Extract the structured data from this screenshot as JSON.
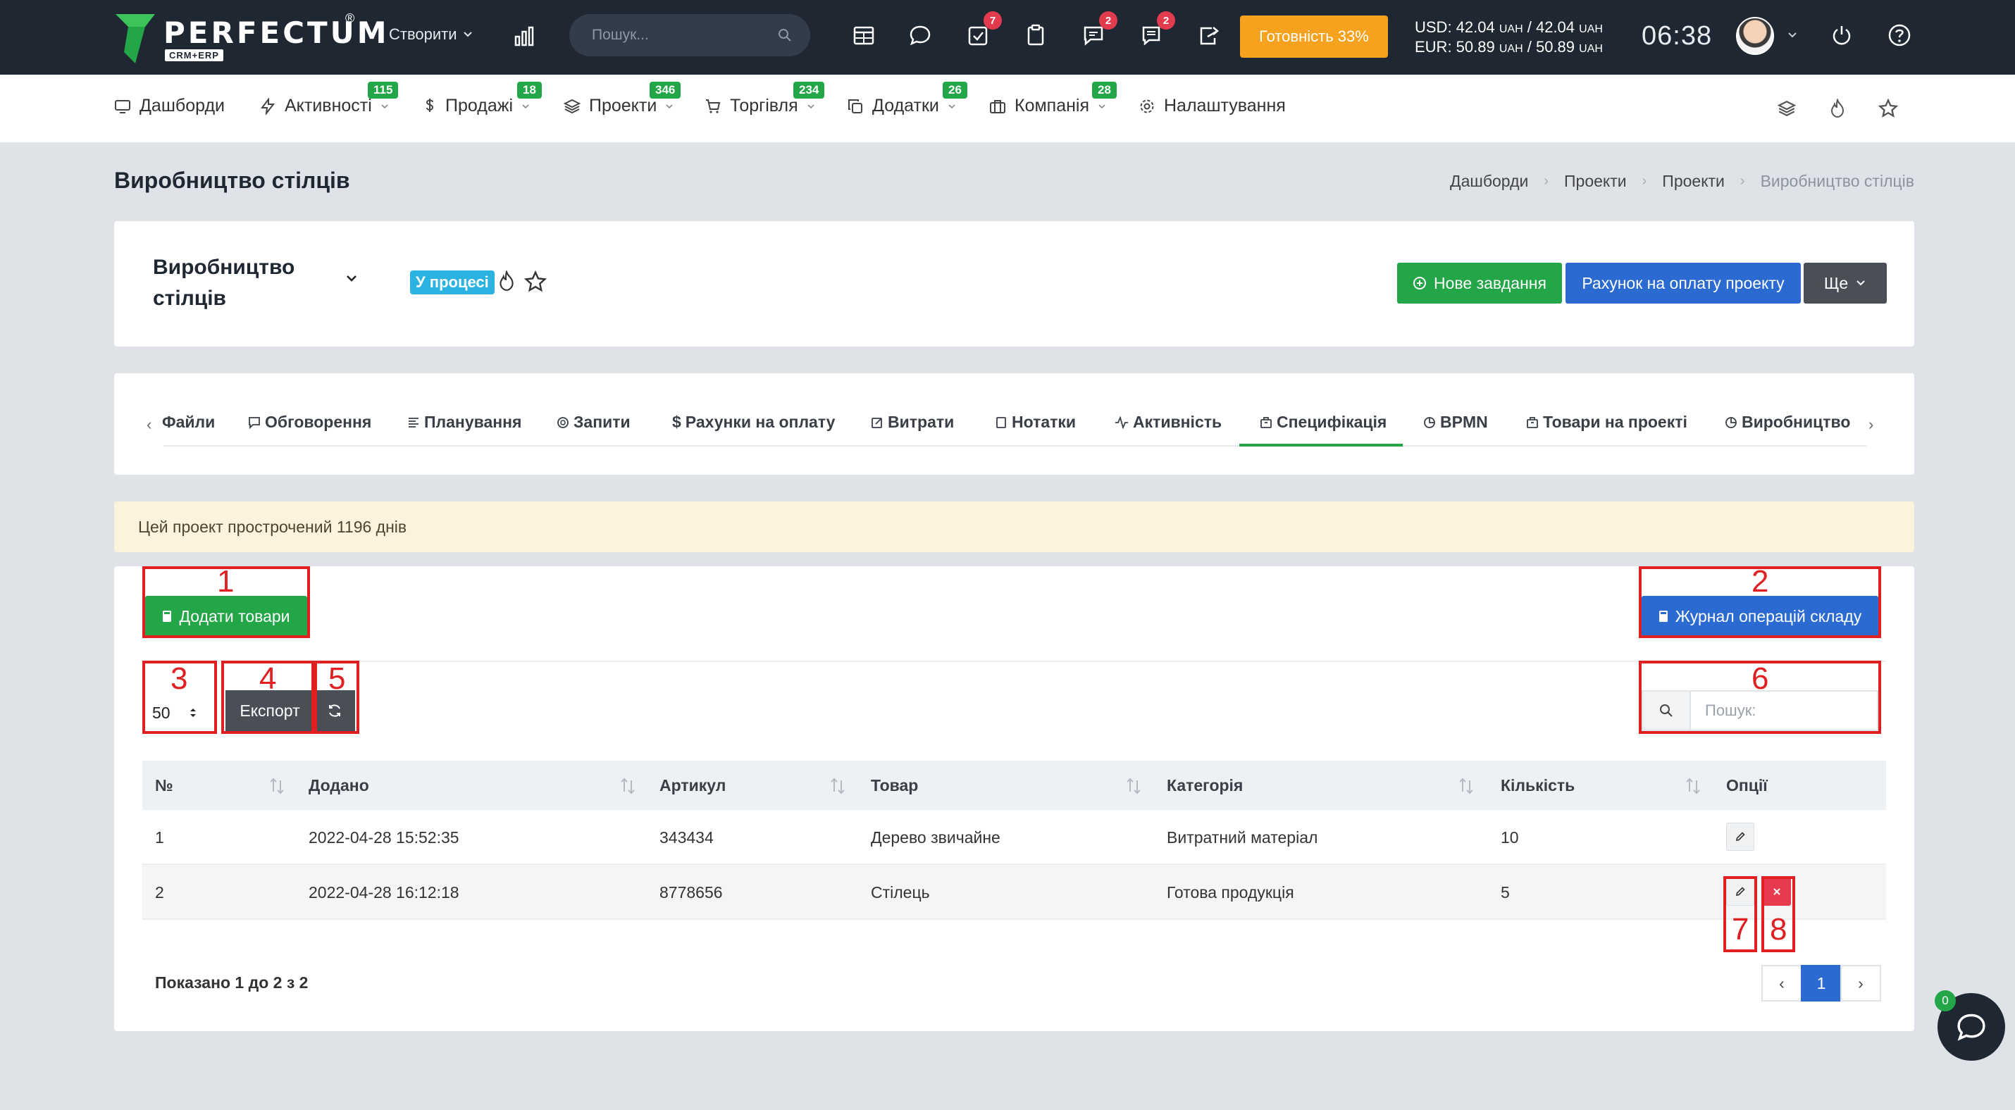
{
  "topbar": {
    "logo_text": "PERFECTUM",
    "logo_reg": "®",
    "logo_sub": "CRM+ERP",
    "create_label": "Створити",
    "search_placeholder": "Пошук...",
    "badges": {
      "tasks": "7",
      "messages": "2",
      "chat": "2"
    },
    "readiness_label": "Готовність 33%",
    "currency_usd": "USD: 42.04",
    "currency_usd_unit1": "UAH",
    "currency_usd_mid": " / 42.04 ",
    "currency_usd_unit2": "UAH",
    "currency_eur": "EUR: 50.89",
    "currency_eur_unit1": "UAH",
    "currency_eur_mid": " / 50.89 ",
    "currency_eur_unit2": "UAH",
    "time": "06:38"
  },
  "nav": {
    "items": [
      {
        "label": "Дашборди",
        "badge": ""
      },
      {
        "label": "Активності",
        "badge": "115"
      },
      {
        "label": "Продажі",
        "badge": "18"
      },
      {
        "label": "Проекти",
        "badge": "346"
      },
      {
        "label": "Торгівля",
        "badge": "234"
      },
      {
        "label": "Додатки",
        "badge": "26"
      },
      {
        "label": "Компанія",
        "badge": "28"
      },
      {
        "label": "Налаштування",
        "badge": ""
      }
    ]
  },
  "page": {
    "title": "Виробництво стілців",
    "breadcrumb": [
      "Дашборди",
      "Проекти",
      "Проекти",
      "Виробництво стілців"
    ]
  },
  "project": {
    "name_line1": "Виробництво",
    "name_line2": "стілців",
    "status": "У процесі",
    "new_task_label": "Нове завдання",
    "invoice_label": "Рахунок на оплату проекту",
    "more_label": "Ще"
  },
  "tabs": {
    "items": [
      "Файли",
      "Обговорення",
      "Планування",
      "Запити",
      "Рахунки на оплату",
      "Витрати",
      "Нотатки",
      "Активність",
      "Специфікація",
      "BPMN",
      "Товари на проекті",
      "Виробництво"
    ],
    "active": "Специфікація"
  },
  "alert": "Цей проект прострочений 1196 днів",
  "spec": {
    "add_goods_label": "Додати товари",
    "warehouse_log_label": "Журнал операцій складу",
    "per_page": "50",
    "export_label": "Експорт",
    "search_placeholder": "Пошук:",
    "columns": [
      "№",
      "Додано",
      "Артикул",
      "Товар",
      "Категорія",
      "Кількість",
      "Опції"
    ],
    "rows": [
      {
        "num": "1",
        "added": "2022-04-28 15:52:35",
        "sku": "343434",
        "product": "Дерево звичайне",
        "category": "Витратний матеріал",
        "qty": "10"
      },
      {
        "num": "2",
        "added": "2022-04-28 16:12:18",
        "sku": "8778656",
        "product": "Стілець",
        "category": "Готова продукція",
        "qty": "5"
      }
    ],
    "showing": "Показано 1 до 2 з 2",
    "current_page": "1"
  },
  "annotations": [
    "1",
    "2",
    "3",
    "4",
    "5",
    "6",
    "7",
    "8"
  ],
  "chat_badge": "0",
  "colors": {
    "topbar_bg": "#1f2732",
    "accent_green": "#22a648",
    "accent_blue": "#2b6bd1",
    "annotation_red": "#e02020",
    "readiness_orange": "#f6a21e"
  }
}
